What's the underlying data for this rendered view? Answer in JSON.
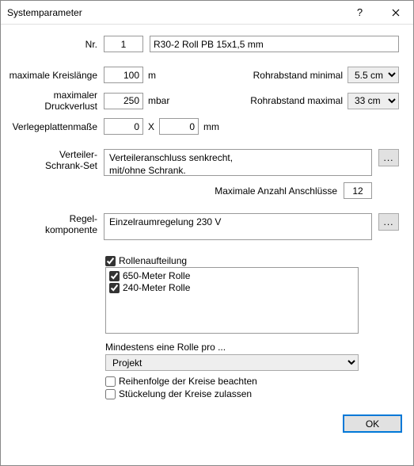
{
  "window": {
    "title": "Systemparameter"
  },
  "nr": {
    "label": "Nr.",
    "value": "1",
    "name": "R30-2 Roll PB 15x1,5 mm"
  },
  "maxCircuit": {
    "label": "maximale Kreislänge",
    "value": "100",
    "unit": "m"
  },
  "maxPressure": {
    "label": "maximaler Druckverlust",
    "value": "250",
    "unit": "mbar"
  },
  "spacingMin": {
    "label": "Rohrabstand minimal",
    "value": "5.5 cm"
  },
  "spacingMax": {
    "label": "Rohrabstand maximal",
    "value": "33 cm"
  },
  "plate": {
    "label": "Verlegeplattenmaße",
    "v1": "0",
    "sep": "X",
    "v2": "0",
    "unit": "mm"
  },
  "verteiler": {
    "label1": "Verteiler-",
    "label2": "Schrank-Set",
    "text": "Verteileranschluss senkrecht,\nmit/ohne Schrank."
  },
  "maxConn": {
    "label": "Maximale Anzahl Anschlüsse",
    "value": "12"
  },
  "regel": {
    "label1": "Regel-",
    "label2": "komponente",
    "text": "Einzelraumregelung 230 V"
  },
  "rolls": {
    "aufteilung": "Rollenaufteilung",
    "items": [
      "650-Meter Rolle",
      "240-Meter Rolle"
    ],
    "minLabel": "Mindestens eine Rolle pro ...",
    "minValue": "Projekt",
    "reihenfolge": "Reihenfolge der Kreise beachten",
    "stueckelung": "Stückelung der Kreise zulassen"
  },
  "footer": {
    "ok": "OK"
  }
}
